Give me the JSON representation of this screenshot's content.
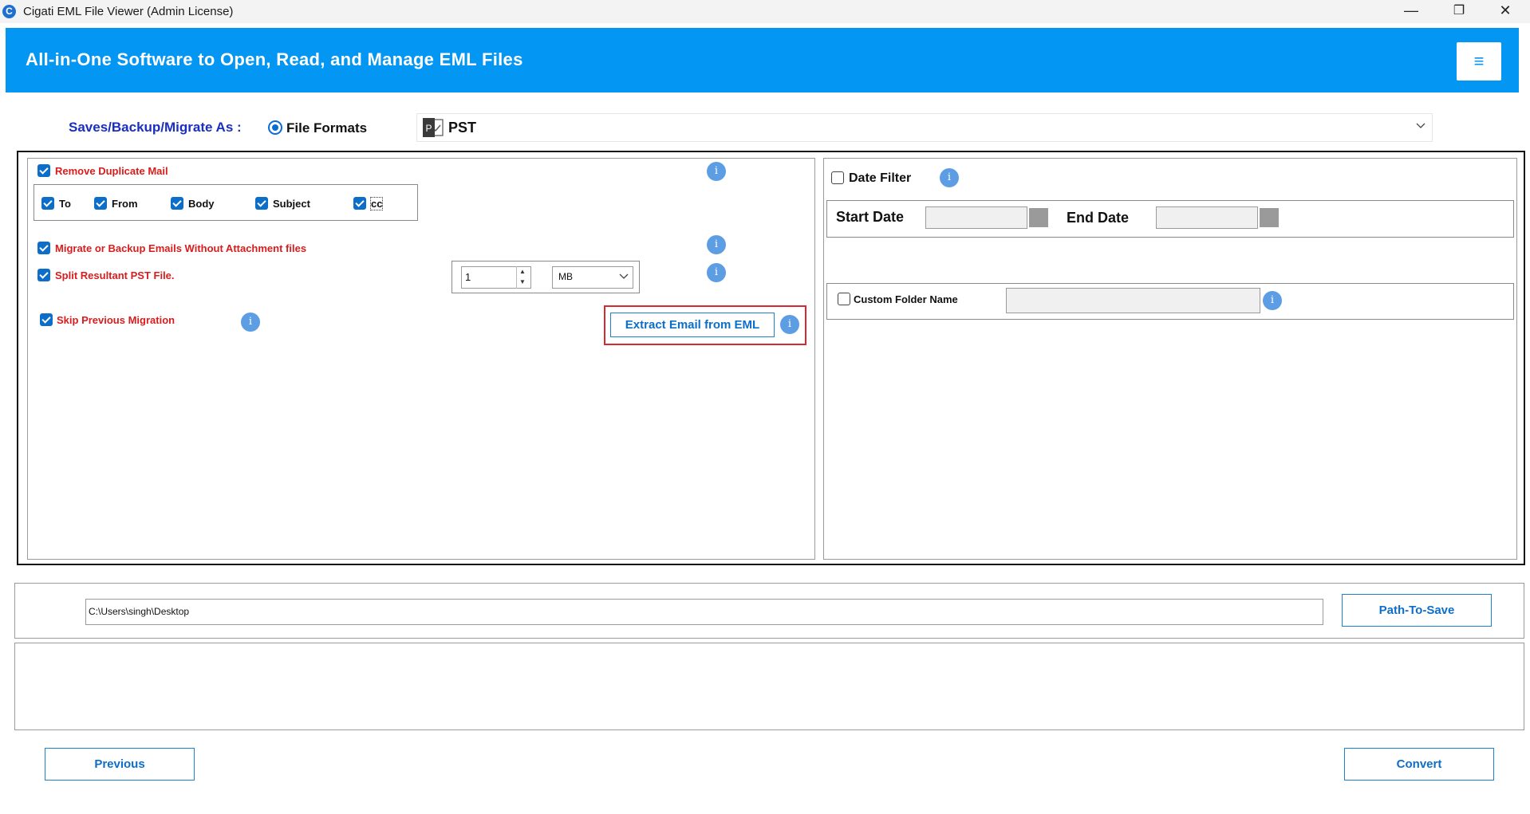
{
  "window": {
    "title": "Cigati EML File Viewer (Admin License)",
    "icon_letter": "C",
    "minimize_glyph": "—",
    "maximize_glyph": "❐",
    "close_glyph": "✕"
  },
  "header": {
    "title": "All-in-One Software to Open, Read, and Manage EML Files",
    "menu_glyph": "≡"
  },
  "format_row": {
    "label": "Saves/Backup/Migrate As :",
    "radio_label": "File Formats",
    "selected_format": "PST",
    "pst_icon_letter": "P"
  },
  "left_options": {
    "remove_duplicate": {
      "label": "Remove Duplicate Mail",
      "checked": true
    },
    "dup_fields": [
      {
        "label": "To",
        "checked": true
      },
      {
        "label": "From",
        "checked": true
      },
      {
        "label": "Body",
        "checked": true
      },
      {
        "label": "Subject",
        "checked": true
      },
      {
        "label": "cc",
        "checked": true
      }
    ],
    "without_attachments": {
      "label": "Migrate or Backup Emails Without Attachment files",
      "checked": true
    },
    "split_pst": {
      "label": "Split Resultant PST File.",
      "checked": true,
      "size_value": "1",
      "size_unit": "MB",
      "spin_up": "▲",
      "spin_down": "▼"
    },
    "skip_previous": {
      "label": "Skip Previous Migration",
      "checked": true
    },
    "extract_button": "Extract Email from EML",
    "info_glyph": "i"
  },
  "right_options": {
    "date_filter": {
      "label": "Date Filter",
      "checked": false
    },
    "start_date_label": "Start Date",
    "end_date_label": "End Date",
    "custom_folder": {
      "label": "Custom Folder Name",
      "checked": false
    }
  },
  "path_row": {
    "path_value": "C:\\Users\\singh\\Desktop",
    "path_button": "Path-To-Save"
  },
  "footer": {
    "previous_button": "Previous",
    "convert_button": "Convert"
  },
  "colors": {
    "header_blue": "#0396f3",
    "checkbox_blue": "#0d6ec9",
    "option_red": "#d91c1c",
    "highlight_red": "#d9282f",
    "label_navy": "#1a2ec0"
  }
}
